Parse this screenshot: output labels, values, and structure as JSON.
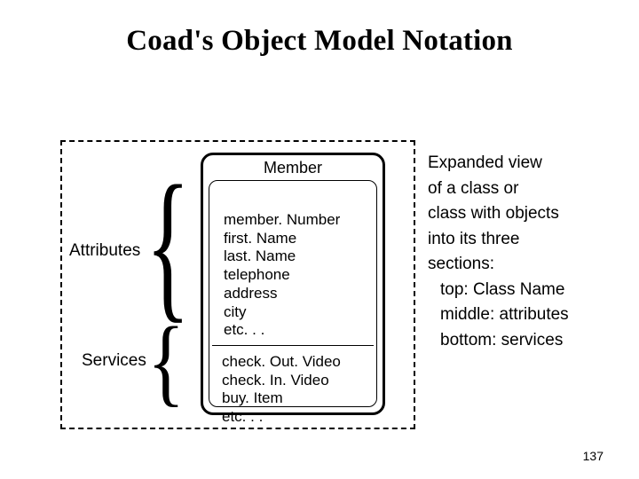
{
  "title": "Coad's Object Model Notation",
  "labels": {
    "attributes": "Attributes",
    "services": "Services"
  },
  "class": {
    "name": "Member",
    "attributes": "member. Number\nfirst. Name\nlast. Name\ntelephone\naddress\ncity\netc. . .",
    "services": "check. Out. Video\ncheck. In. Video\nbuy. Item\netc. . ."
  },
  "description": {
    "l1": "Expanded view",
    "l2": "of a class or",
    "l3": "class with objects",
    "l4": "into its three",
    "l5": "sections:",
    "l6": "top: Class Name",
    "l7": "middle: attributes",
    "l8": "bottom: services"
  },
  "page_number": "137"
}
